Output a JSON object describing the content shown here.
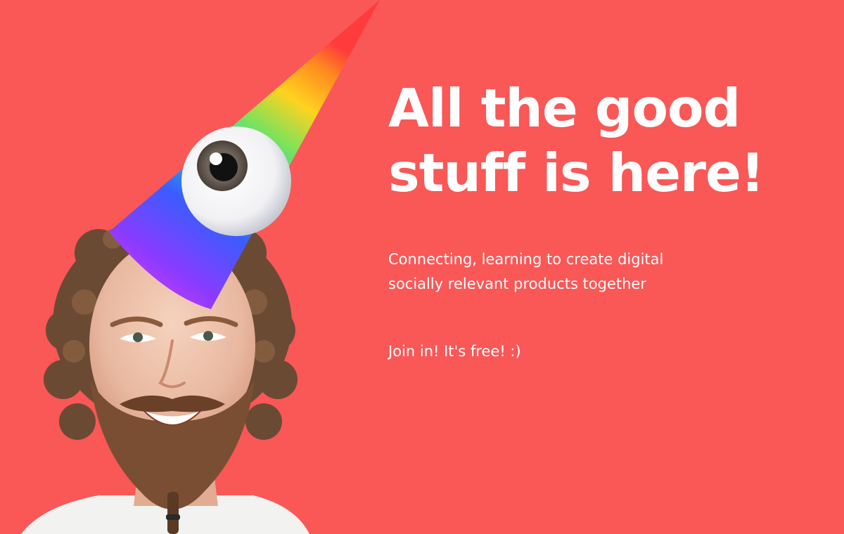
{
  "hero": {
    "headline_lines": [
      "All the good",
      "stuff is here!"
    ],
    "subtitle_lines": [
      "Connecting, learning to create digital",
      "socially relevant products together"
    ],
    "cta_text": "Join in! It's free! :)"
  },
  "colors": {
    "background": "#fa5757",
    "text": "#ffffff"
  },
  "illustration": {
    "subject": "bearded-man-photo",
    "hat": "rainbow-party-hat-icon",
    "eye": "eyeball-icon"
  }
}
